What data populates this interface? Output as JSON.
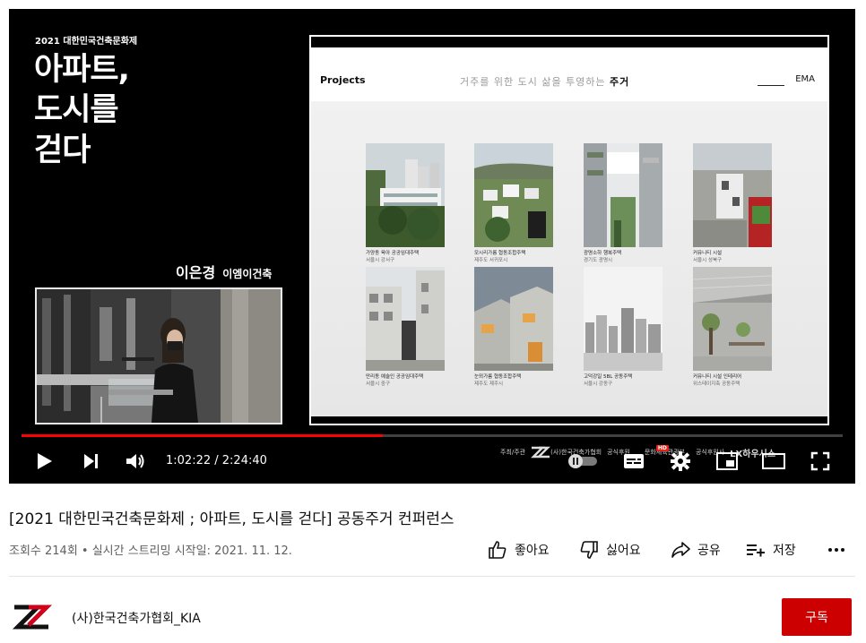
{
  "player": {
    "festival_label": "2021 대한민국건축문화제",
    "big_title": "아파트,\n도시를\n걷다",
    "speaker_name": "이은경",
    "speaker_org": "이엠이건축",
    "time_current": "1:02:22",
    "time_total": "2:24:40",
    "progress_played": 0.44,
    "progress_loaded": 0.44,
    "slide": {
      "section": "Projects",
      "theme_gray": "거주를 위한 도시 삶을 투영하는",
      "theme_bold": "주거",
      "brand": "EMA",
      "projects": [
        {
          "title": "가양동 육아 공공임대주택",
          "location": "서울시 강서구"
        },
        {
          "title": "모시리가름 협동조합주택",
          "location": "제주도 서귀포시"
        },
        {
          "title": "광명소하 행복주택",
          "location": "경기도 광명시"
        },
        {
          "title": "커뮤니티 시설",
          "location": "서울시 성북구"
        },
        {
          "title": "만리동 예술인 공공임대주택",
          "location": "서울시 중구"
        },
        {
          "title": "눈뫼가름 협동조합주택",
          "location": "제주도 제주시"
        },
        {
          "title": "고덕강일 5BL 공동주택",
          "location": "서울시 강동구"
        },
        {
          "title": "커뮤니티 시설 인테리어",
          "location": "위스테이지축 공동주택"
        }
      ]
    },
    "sponsors": {
      "host_label": "주최/주관",
      "host_name": "(사)한국건축가협회",
      "support_label": "공식후원",
      "ministry": "문화체육관광부",
      "partner_label": "공식후원사",
      "partner": "LX하우시스"
    }
  },
  "video": {
    "title": "[2021 대한민국건축문화제 ; 아파트, 도시를 걷다] 공동주거 컨퍼런스",
    "meta": "조회수 214회 • 실시간 스트리밍 시작일: 2021. 11. 12.",
    "like_label": "좋아요",
    "dislike_label": "싫어요",
    "share_label": "공유",
    "save_label": "저장"
  },
  "channel": {
    "name": "(사)한국건축가협회_KIA",
    "subscribe_label": "구독"
  }
}
